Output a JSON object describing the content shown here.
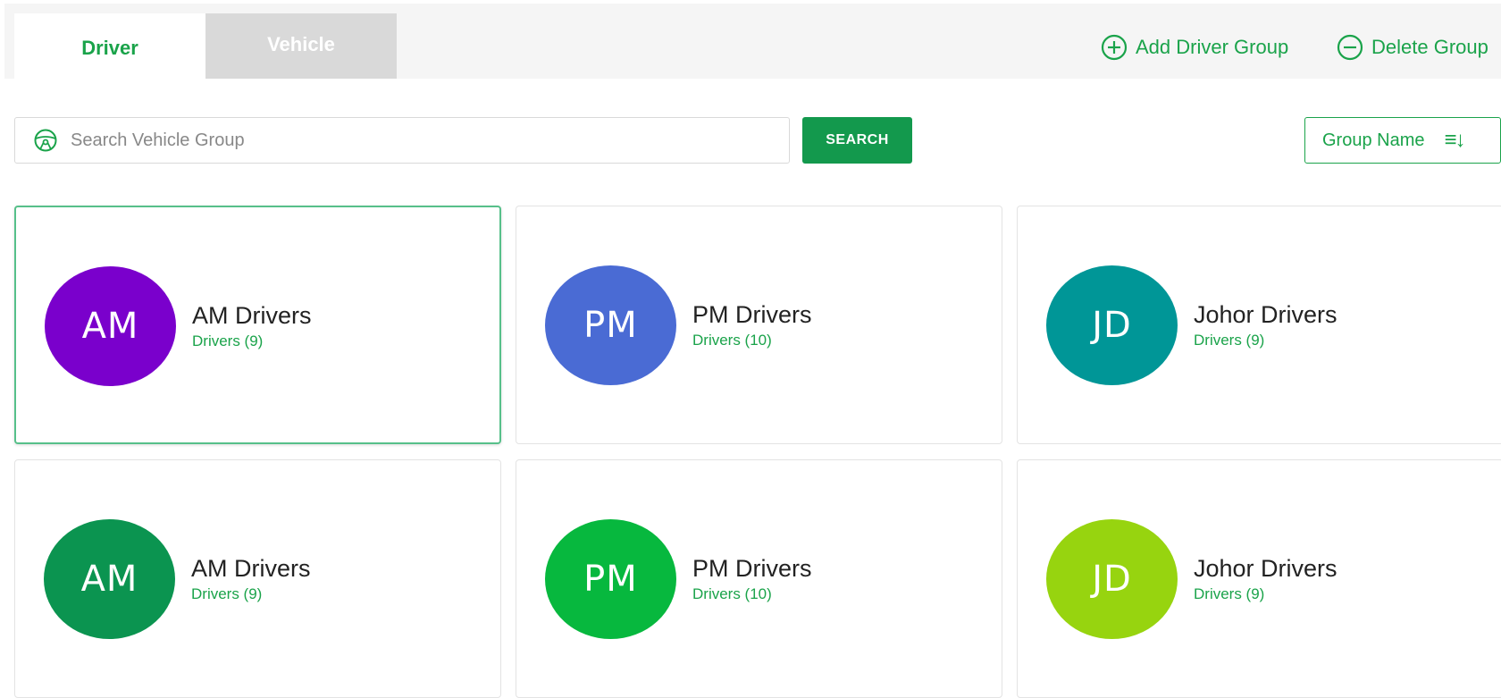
{
  "tabs": [
    {
      "label": "Driver",
      "active": true
    },
    {
      "label": "Vehicle",
      "active": false
    }
  ],
  "actions": {
    "add_label": "Add Driver Group",
    "delete_label": "Delete Group"
  },
  "search": {
    "placeholder": "Search Vehicle Group",
    "value": "",
    "button_label": "SEARCH"
  },
  "sort": {
    "label": "Group Name",
    "icon": "sort-descending-icon"
  },
  "colors": {
    "accent": "#1aa34a",
    "button": "#13994d"
  },
  "groups": [
    {
      "initials": "AM",
      "name": "AM Drivers",
      "count_text": "Drivers (9)",
      "color": "#7a00cc",
      "selected": true
    },
    {
      "initials": "PM",
      "name": "PM Drivers",
      "count_text": "Drivers (10)",
      "color": "#4a6bd4",
      "selected": false
    },
    {
      "initials": "JD",
      "name": "Johor Drivers",
      "count_text": "Drivers (9)",
      "color": "#009697",
      "selected": false
    },
    {
      "initials": "AM",
      "name": "AM Drivers",
      "count_text": "Drivers (9)",
      "color": "#0b9450",
      "selected": false
    },
    {
      "initials": "PM",
      "name": "PM Drivers",
      "count_text": "Drivers (10)",
      "color": "#07b83e",
      "selected": false
    },
    {
      "initials": "JD",
      "name": "Johor Drivers",
      "count_text": "Drivers (9)",
      "color": "#97d40f",
      "selected": false
    }
  ]
}
